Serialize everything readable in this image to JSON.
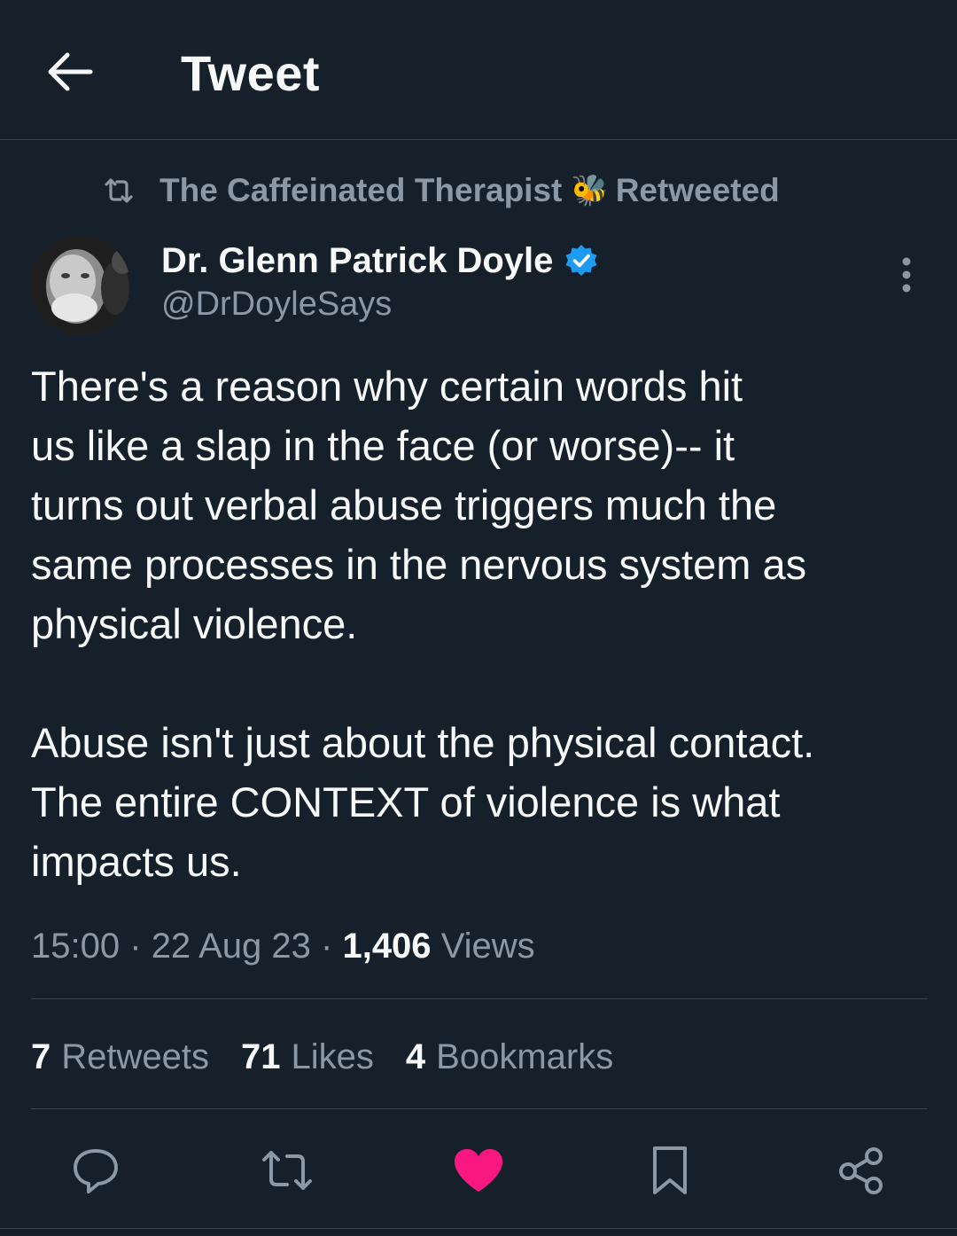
{
  "header": {
    "title": "Tweet",
    "back_icon": "arrow-left-icon"
  },
  "retweet": {
    "retweeter": "The Caffeinated Therapist",
    "emoji": "🐝",
    "suffix": "Retweeted"
  },
  "author": {
    "name": "Dr. Glenn Patrick Doyle",
    "handle": "@DrDoyleSays",
    "verified": true
  },
  "tweet": {
    "text": "There's a reason why certain words hit\nus like a slap in the face (or worse)-- it\nturns out verbal abuse triggers much the\nsame processes in the nervous system as\nphysical violence.\n\nAbuse isn't just about the physical contact.\nThe entire CONTEXT of violence is what\nimpacts us."
  },
  "meta": {
    "time": "15:00",
    "date": "22 Aug 23",
    "views_count": "1,406",
    "views_label": "Views",
    "separator": "·"
  },
  "stats": {
    "retweets_count": "7",
    "retweets_label": "Retweets",
    "likes_count": "71",
    "likes_label": "Likes",
    "bookmarks_count": "4",
    "bookmarks_label": "Bookmarks"
  },
  "actions": [
    "reply-icon",
    "retweet-icon",
    "heart-icon",
    "bookmark-icon",
    "share-icon"
  ],
  "colors": {
    "background": "#15202b",
    "text": "#f7f9f9",
    "secondary": "#8b98a5",
    "divider": "#38444d",
    "verified": "#1d9bf0",
    "like": "#f91880"
  }
}
